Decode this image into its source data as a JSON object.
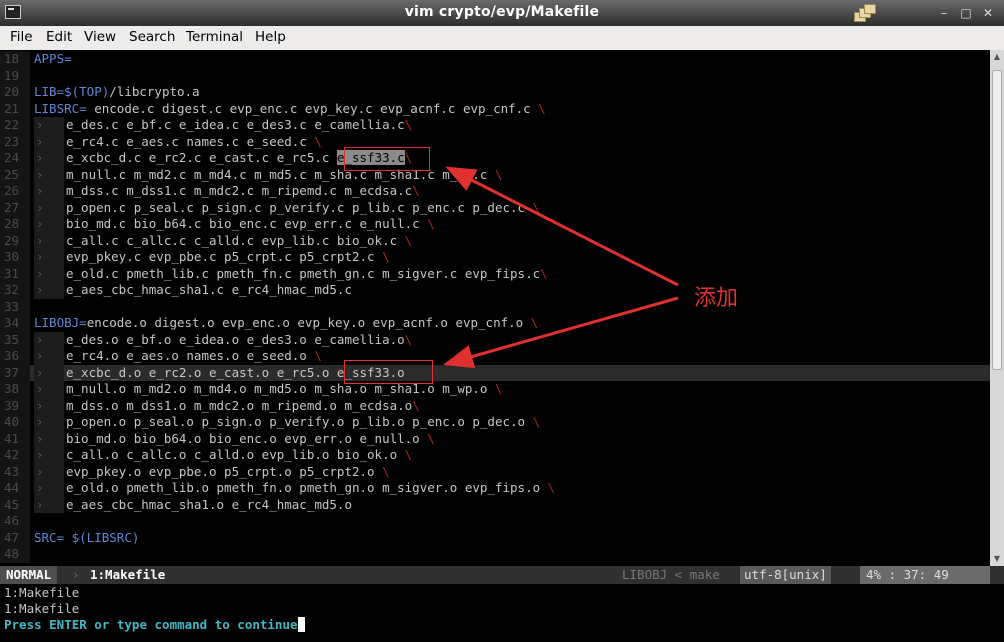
{
  "window": {
    "title": "vim crypto/evp/Makefile"
  },
  "menu": [
    "File",
    "Edit",
    "View",
    "Search",
    "Terminal",
    "Help"
  ],
  "lines": [
    {
      "n": "18",
      "segs": [
        [
          "APPS=",
          "kw"
        ]
      ]
    },
    {
      "n": "19",
      "segs": []
    },
    {
      "n": "20",
      "segs": [
        [
          "LIB=",
          "kw"
        ],
        [
          "$(TOP)",
          "kw"
        ],
        [
          "/libcrypto.a",
          ""
        ]
      ]
    },
    {
      "n": "21",
      "segs": [
        [
          "LIBSRC=",
          "kw"
        ],
        [
          " encode.c digest.c evp_enc.c evp_key.c evp_acnf.c evp_cnf.c ",
          ""
        ],
        [
          "\\",
          "bs"
        ]
      ]
    },
    {
      "n": "22",
      "cont": true,
      "segs": [
        [
          "e_des.c e_bf.c e_idea.c e_des3.c e_camellia.c",
          ""
        ],
        [
          "\\",
          "bs"
        ]
      ]
    },
    {
      "n": "23",
      "cont": true,
      "segs": [
        [
          "e_rc4.c e_aes.c names.c e_seed.c ",
          ""
        ],
        [
          "\\",
          "bs"
        ]
      ]
    },
    {
      "n": "24",
      "cont": true,
      "segs": [
        [
          "e_xcbc_d.c e_rc2.c e_cast.c e_rc5.c ",
          ""
        ],
        [
          "e_ssf33.c",
          "sel"
        ],
        [
          "\\",
          "bs"
        ]
      ]
    },
    {
      "n": "25",
      "cont": true,
      "segs": [
        [
          "m_null.c m_md2.c m_md4.c m_md5.c m_sha.c m_sha1.c m_wp.c ",
          ""
        ],
        [
          "\\",
          "bs"
        ]
      ]
    },
    {
      "n": "26",
      "cont": true,
      "segs": [
        [
          "m_dss.c m_dss1.c m_mdc2.c m_ripemd.c m_ecdsa.c",
          ""
        ],
        [
          "\\",
          "bs"
        ]
      ]
    },
    {
      "n": "27",
      "cont": true,
      "segs": [
        [
          "p_open.c p_seal.c p_sign.c p_verify.c p_lib.c p_enc.c p_dec.c ",
          ""
        ],
        [
          "\\",
          "bs"
        ]
      ]
    },
    {
      "n": "28",
      "cont": true,
      "segs": [
        [
          "bio_md.c bio_b64.c bio_enc.c evp_err.c e_null.c ",
          ""
        ],
        [
          "\\",
          "bs"
        ]
      ]
    },
    {
      "n": "29",
      "cont": true,
      "segs": [
        [
          "c_all.c c_allc.c c_alld.c evp_lib.c bio_ok.c ",
          ""
        ],
        [
          "\\",
          "bs"
        ]
      ]
    },
    {
      "n": "30",
      "cont": true,
      "segs": [
        [
          "evp_pkey.c evp_pbe.c p5_crpt.c p5_crpt2.c ",
          ""
        ],
        [
          "\\",
          "bs"
        ]
      ]
    },
    {
      "n": "31",
      "cont": true,
      "segs": [
        [
          "e_old.c pmeth_lib.c pmeth_fn.c pmeth_gn.c m_sigver.c evp_fips.c",
          ""
        ],
        [
          "\\",
          "bs"
        ]
      ]
    },
    {
      "n": "32",
      "cont": true,
      "segs": [
        [
          "e_aes_cbc_hmac_sha1.c e_rc4_hmac_md5.c",
          ""
        ]
      ]
    },
    {
      "n": "33",
      "segs": []
    },
    {
      "n": "34",
      "segs": [
        [
          "LIBOBJ=",
          "kw"
        ],
        [
          "encode.o digest.o evp_enc.o evp_key.o evp_acnf.o evp_cnf.o ",
          ""
        ],
        [
          "\\",
          "bs"
        ]
      ]
    },
    {
      "n": "35",
      "cont": true,
      "segs": [
        [
          "e_des.o e_bf.o e_idea.o e_des3.o e_camellia.o",
          ""
        ],
        [
          "\\",
          "bs"
        ]
      ]
    },
    {
      "n": "36",
      "cont": true,
      "segs": [
        [
          "e_rc4.o e_aes.o names.o e_seed.o ",
          ""
        ],
        [
          "\\",
          "bs"
        ]
      ]
    },
    {
      "n": "37",
      "cont": true,
      "cur": true,
      "segs": [
        [
          "e_xcbc_d.o e_rc2.o e_cast.o e_rc5.o e_ssf33.o",
          ""
        ]
      ]
    },
    {
      "n": "38",
      "cont": true,
      "segs": [
        [
          "m_null.o m_md2.o m_md4.o m_md5.o m_sha.o m_sha1.o m_wp.o ",
          ""
        ],
        [
          "\\",
          "bs"
        ]
      ]
    },
    {
      "n": "39",
      "cont": true,
      "segs": [
        [
          "m_dss.o m_dss1.o m_mdc2.o m_ripemd.o m_ecdsa.o",
          ""
        ],
        [
          "\\",
          "bs"
        ]
      ]
    },
    {
      "n": "40",
      "cont": true,
      "segs": [
        [
          "p_open.o p_seal.o p_sign.o p_verify.o p_lib.o p_enc.o p_dec.o ",
          ""
        ],
        [
          "\\",
          "bs"
        ]
      ]
    },
    {
      "n": "41",
      "cont": true,
      "segs": [
        [
          "bio_md.o bio_b64.o bio_enc.o evp_err.o e_null.o ",
          ""
        ],
        [
          "\\",
          "bs"
        ]
      ]
    },
    {
      "n": "42",
      "cont": true,
      "segs": [
        [
          "c_all.o c_allc.o c_alld.o evp_lib.o bio_ok.o ",
          ""
        ],
        [
          "\\",
          "bs"
        ]
      ]
    },
    {
      "n": "43",
      "cont": true,
      "segs": [
        [
          "evp_pkey.o evp_pbe.o p5_crpt.o p5_crpt2.o ",
          ""
        ],
        [
          "\\",
          "bs"
        ]
      ]
    },
    {
      "n": "44",
      "cont": true,
      "segs": [
        [
          "e_old.o pmeth_lib.o pmeth_fn.o pmeth_gn.o m_sigver.o evp_fips.o ",
          ""
        ],
        [
          "\\",
          "bs"
        ]
      ]
    },
    {
      "n": "45",
      "cont": true,
      "segs": [
        [
          "e_aes_cbc_hmac_sha1.o e_rc4_hmac_md5.o",
          ""
        ]
      ]
    },
    {
      "n": "46",
      "segs": []
    },
    {
      "n": "47",
      "segs": [
        [
          "SRC=",
          "kw"
        ],
        [
          " $(LIBSRC)",
          "kw"
        ]
      ]
    },
    {
      "n": "48",
      "segs": []
    }
  ],
  "statusline": {
    "mode": "NORMAL",
    "buffer": "1:Makefile",
    "context": "LIBOBJ < make",
    "encoding": "utf-8[unix]",
    "position": "4% :  37: 49"
  },
  "messages": [
    "1:Makefile",
    "1:Makefile"
  ],
  "prompt": "Press ENTER or type command to continue",
  "annotation": {
    "label": "添加",
    "color": "#e03030"
  }
}
